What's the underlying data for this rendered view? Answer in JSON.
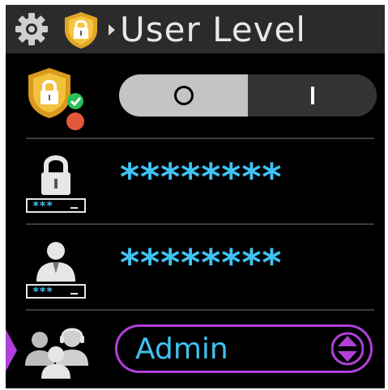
{
  "header": {
    "title": "User Level",
    "icons": [
      "gear-icon",
      "shield-lock-icon",
      "breadcrumb-arrow-icon"
    ]
  },
  "rows": {
    "security_toggle": {
      "icon": "shield-lock-status-icon",
      "off_symbol": "O",
      "on_symbol": "I",
      "selected": "off"
    },
    "lock_password": {
      "icon": "lock-password-icon",
      "icon_caption": "***_",
      "value": "********"
    },
    "user_password": {
      "icon": "user-password-icon",
      "icon_caption": "***_",
      "value": "********"
    },
    "user_level": {
      "icon": "users-headset-icon",
      "value": "Admin",
      "control_icon": "up-down-arrows-icon"
    }
  },
  "colors": {
    "background": "#000000",
    "header": "#2b2b2b",
    "accent_text": "#3fc3f3",
    "selection": "#b040d8",
    "toggle_off": "#c4c4c4",
    "toggle_on": "#333333"
  }
}
